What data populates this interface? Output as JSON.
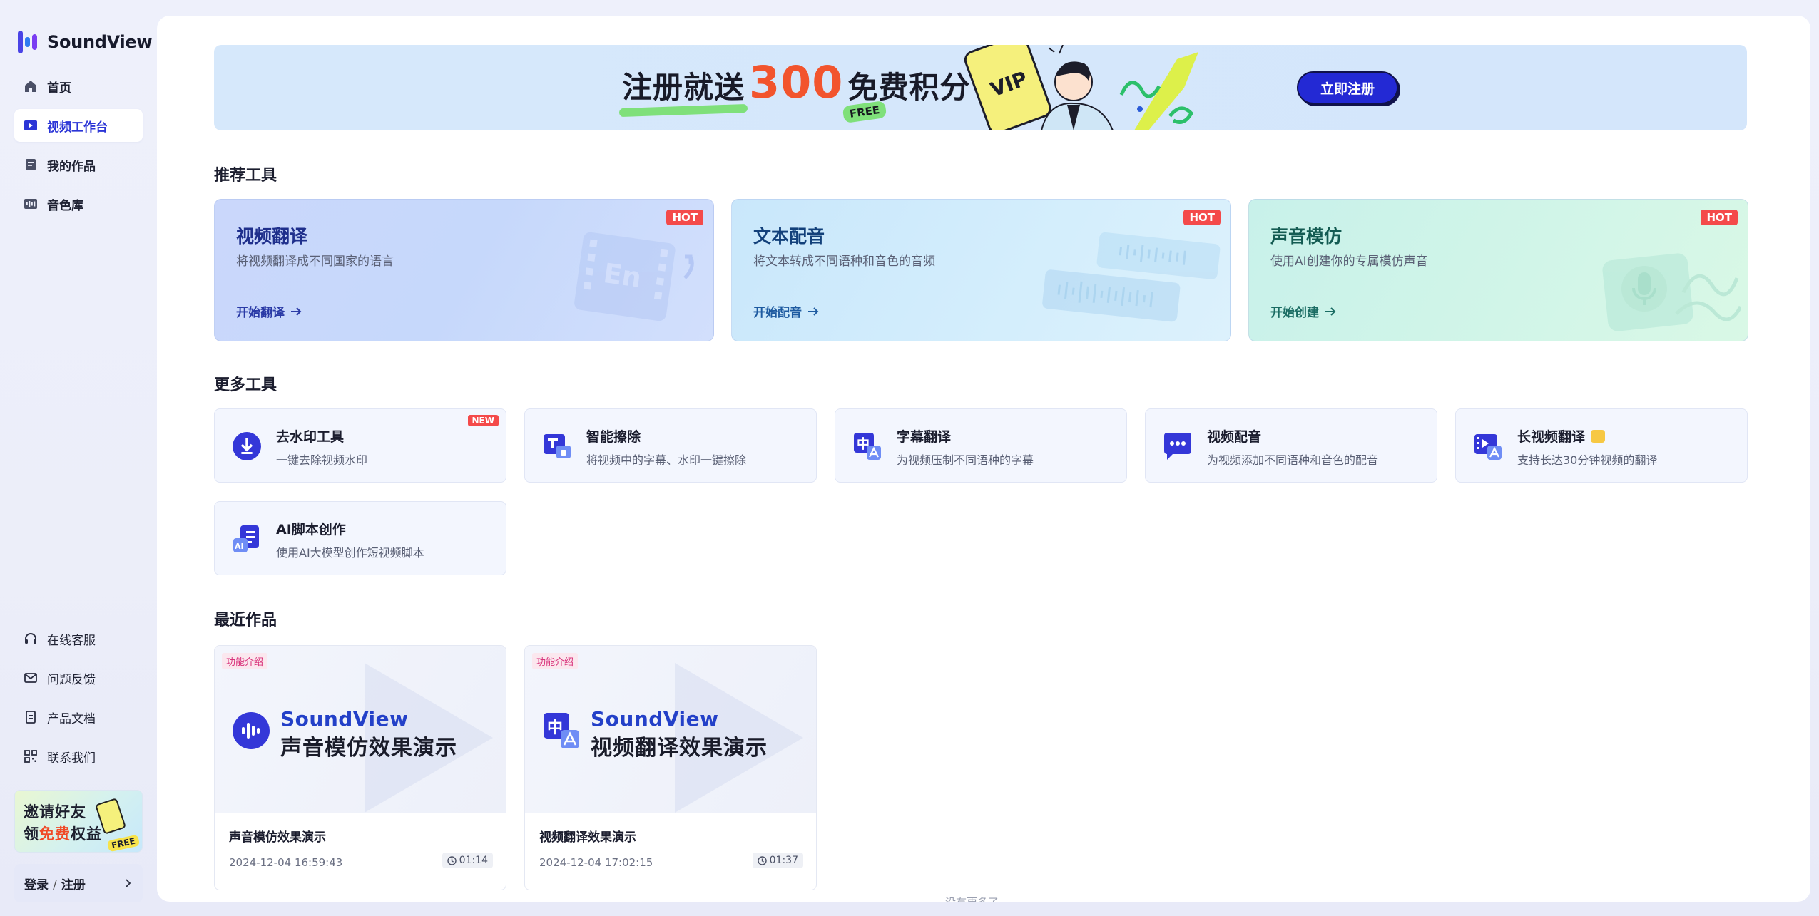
{
  "app": {
    "name": "SoundView",
    "brand_color": "#2b35d6"
  },
  "sidebar": {
    "nav": [
      {
        "label": "首页",
        "icon": "home-icon"
      },
      {
        "label": "视频工作台",
        "icon": "video-workbench-icon",
        "active": true
      },
      {
        "label": "我的作品",
        "icon": "document-icon"
      },
      {
        "label": "音色库",
        "icon": "waveform-icon"
      }
    ],
    "links": [
      {
        "label": "在线客服",
        "icon": "headset-icon"
      },
      {
        "label": "问题反馈",
        "icon": "mail-icon"
      },
      {
        "label": "产品文档",
        "icon": "file-icon"
      },
      {
        "label": "联系我们",
        "icon": "qrcode-icon"
      }
    ],
    "invite": {
      "line1": "邀请好友",
      "line2_prefix": "领",
      "line2_highlight": "免费",
      "line2_suffix": "权益",
      "badge": "FREE"
    },
    "login": {
      "login": "登录",
      "sep": "/",
      "register": "注册"
    }
  },
  "banner": {
    "title_prefix": "注册就送",
    "title_number": "300",
    "title_suffix": "免费积分",
    "free_badge": "FREE",
    "vip_text": "VIP",
    "cta": "立即注册"
  },
  "sections": {
    "recommended": "推荐工具",
    "more": "更多工具",
    "recent": "最近作品"
  },
  "recommended_tools": [
    {
      "title": "视频翻译",
      "desc": "将视频翻译成不同国家的语言",
      "action": "开始翻译",
      "badge": "HOT",
      "deco_text": "En"
    },
    {
      "title": "文本配音",
      "desc": "将文本转成不同语种和音色的音频",
      "action": "开始配音",
      "badge": "HOT"
    },
    {
      "title": "声音模仿",
      "desc": "使用AI创建你的专属模仿声音",
      "action": "开始创建",
      "badge": "HOT"
    }
  ],
  "more_tools": [
    {
      "title": "去水印工具",
      "desc": "一键去除视频水印",
      "badge": "NEW",
      "icon": "download-icon"
    },
    {
      "title": "智能擦除",
      "desc": "将视频中的字幕、水印一键擦除",
      "icon": "erase-icon"
    },
    {
      "title": "字幕翻译",
      "desc": "为视频压制不同语种的字幕",
      "icon": "subtitle-translate-icon"
    },
    {
      "title": "视频配音",
      "desc": "为视频添加不同语种和音色的配音",
      "icon": "chat-bubble-icon"
    },
    {
      "title": "长视频翻译",
      "desc": "支持长达30分钟视频的翻译",
      "icon": "long-video-icon",
      "crown": true
    },
    {
      "title": "AI脚本创作",
      "desc": "使用AI大模型创作短视频脚本",
      "icon": "ai-script-icon"
    }
  ],
  "recent_works": [
    {
      "tag": "功能介绍",
      "brand": "SoundView",
      "subtitle": "声音模仿效果演示",
      "title": "声音模仿效果演示",
      "date": "2024-12-04 16:59:43",
      "duration": "01:14"
    },
    {
      "tag": "功能介绍",
      "brand": "SoundView",
      "subtitle": "视频翻译效果演示",
      "title": "视频翻译效果演示",
      "date": "2024-12-04 17:02:15",
      "duration": "01:37"
    }
  ],
  "footer_note": "没有更多了"
}
